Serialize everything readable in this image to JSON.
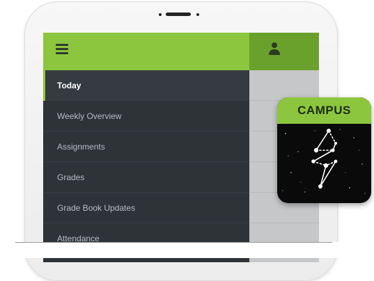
{
  "app": {
    "nav_items": [
      {
        "label": "Today",
        "active": true
      },
      {
        "label": "Weekly Overview",
        "active": false
      },
      {
        "label": "Assignments",
        "active": false
      },
      {
        "label": "Grades",
        "active": false
      },
      {
        "label": "Grade Book Updates",
        "active": false
      },
      {
        "label": "Attendance",
        "active": false
      }
    ],
    "icons": {
      "menu": "hamburger-menu-icon",
      "user": "user-icon"
    }
  },
  "app_icon": {
    "label": "CAMPUS",
    "logo": "constellation-logo"
  },
  "colors": {
    "accent": "#8cc63f",
    "accent_dark": "#6aa12d",
    "drawer": "#2e3338",
    "icon_bg": "#0a0a0a"
  }
}
